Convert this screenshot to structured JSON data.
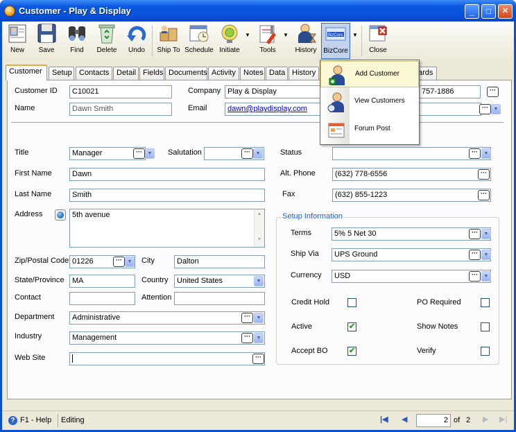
{
  "window": {
    "title": "Customer - Play & Display",
    "min": "_",
    "max": "□",
    "close": "✕"
  },
  "toolbar": {
    "new": "New",
    "save": "Save",
    "find": "Find",
    "delete": "Delete",
    "undo": "Undo",
    "ship_to": "Ship To",
    "schedule": "Schedule",
    "initiate": "Initiate",
    "tools": "Tools",
    "history": "History",
    "bizcore": "BizCore",
    "close": "Close"
  },
  "tabs": [
    "Customer",
    "Setup",
    "Contacts",
    "Detail",
    "Fields",
    "Documents",
    "Activity",
    "Notes",
    "Data",
    "History",
    "ards"
  ],
  "form": {
    "customer_id_label": "Customer ID",
    "customer_id": "C10021",
    "company_label": "Company",
    "company": "Play & Display",
    "phone_partial": "757-1886",
    "name_label": "Name",
    "name": "Dawn Smith",
    "email_label": "Email",
    "email": "dawn@playdisplay.com",
    "title_label": "Title",
    "title": "Manager",
    "salutation_label": "Salutation",
    "salutation": "",
    "status_label": "Status",
    "status": "",
    "first_name_label": "First Name",
    "first_name": "Dawn",
    "alt_phone_label": "Alt. Phone",
    "alt_phone": "(632) 778-6556",
    "last_name_label": "Last Name",
    "last_name": "Smith",
    "fax_label": "Fax",
    "fax": "(632) 855-1223",
    "address_label": "Address",
    "address": "5th avenue",
    "zip_label": "Zip/Postal Code",
    "zip": "01226",
    "city_label": "City",
    "city": "Dalton",
    "state_label": "State/Province",
    "state": "MA",
    "country_label": "Country",
    "country": "United States",
    "contact_label": "Contact",
    "contact": "",
    "attention_label": "Attention",
    "attention": "",
    "department_label": "Department",
    "department": "Administrative",
    "industry_label": "Industry",
    "industry": "Management",
    "website_label": "Web Site",
    "website": ""
  },
  "setup": {
    "group_title": "Setup Information",
    "terms_label": "Terms",
    "terms": "5% 5 Net 30",
    "ship_via_label": "Ship Via",
    "ship_via": "UPS Ground",
    "currency_label": "Currency",
    "currency": "USD",
    "credit_hold_label": "Credit Hold",
    "credit_hold": false,
    "po_required_label": "PO Required",
    "po_required": false,
    "active_label": "Active",
    "active": true,
    "show_notes_label": "Show Notes",
    "show_notes": false,
    "accept_bo_label": "Accept BO",
    "accept_bo": true,
    "verify_label": "Verify",
    "verify": false
  },
  "menu": {
    "items": [
      "Add Customer",
      "View Customers",
      "Forum Post"
    ]
  },
  "status": {
    "help": "F1 - Help",
    "mode": "Editing",
    "page": "2",
    "of_label": "of",
    "total": "2"
  },
  "colors": {
    "title_bar": "#0a58e0",
    "panel": "#fcfcfe",
    "frame": "#ece9d8",
    "accent_tab": "#f2a33a",
    "link": "#0000cc",
    "check": "#21a121"
  }
}
